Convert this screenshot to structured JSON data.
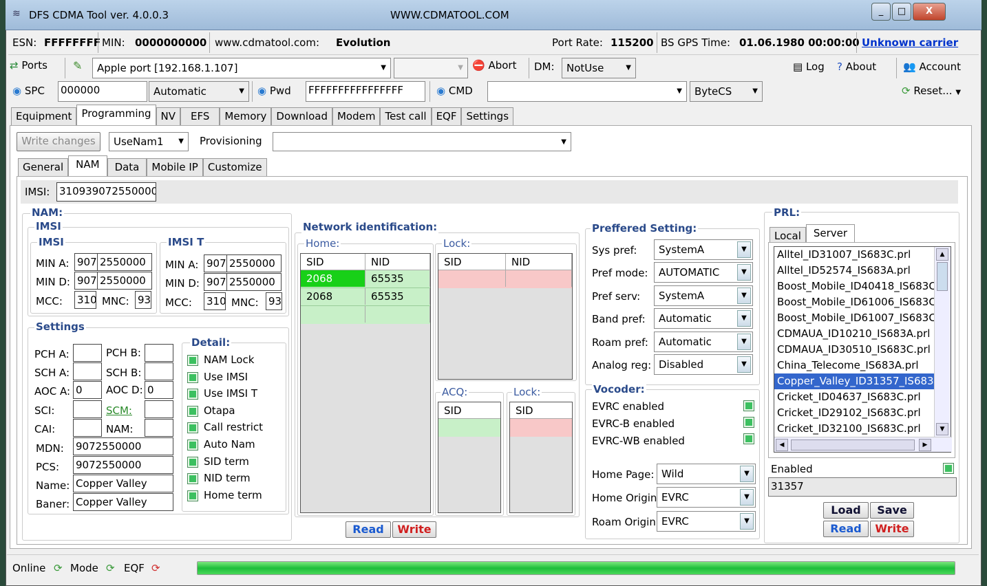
{
  "window": {
    "title": "DFS CDMA Tool ver. 4.0.0.3",
    "url_title": "WWW.CDMATOOL.COM",
    "min_label": "_",
    "max_label": "□",
    "close_label": "X"
  },
  "infobar": {
    "esn_label": "ESN:",
    "esn_value": "FFFFFFFF",
    "min_label": "MIN:",
    "min_value": "0000000000",
    "site_label": "www.cdmatool.com:",
    "site_value": "Evolution",
    "port_rate_label": "Port Rate:",
    "port_rate_value": "115200",
    "gps_label": "BS GPS Time:",
    "gps_value": "01.06.1980 00:00:00",
    "carrier_link": "Unknown carrier"
  },
  "toolbar1": {
    "ports": "Ports",
    "port_value": "Apple port [192.168.1.107]",
    "abort": "Abort",
    "dm_label": "DM:",
    "dm_value": "NotUse",
    "log": "Log",
    "about": "About",
    "account": "Account"
  },
  "toolbar2": {
    "spc_label": "SPC",
    "spc_value": "000000",
    "mode_value": "Automatic",
    "pwd_label": "Pwd",
    "pwd_value": "FFFFFFFFFFFFFFFF",
    "cmd_label": "CMD",
    "cmd_value": "",
    "bytecs_value": "ByteCS",
    "reset": "Reset..."
  },
  "main_tabs": [
    "Equipment",
    "Programming",
    "NV",
    "EFS",
    "Memory",
    "Download",
    "Modem",
    "Test call",
    "EQF",
    "Settings"
  ],
  "prog_bar": {
    "write_changes": "Write changes",
    "nam_select": "UseNam1",
    "provisioning_label": "Provisioning",
    "provisioning_value": ""
  },
  "sub_tabs": [
    "General",
    "NAM",
    "Data",
    "Mobile IP",
    "Customize"
  ],
  "imsi_bar": {
    "label": "IMSI:",
    "value": "310939072550000"
  },
  "nam": {
    "title": "NAM:",
    "imsi_group": "IMSI",
    "imsi": {
      "title": "IMSI",
      "min_a_label": "MIN A:",
      "min_a_1": "907",
      "min_a_2": "2550000",
      "min_d_label": "MIN D:",
      "min_d_1": "907",
      "min_d_2": "2550000",
      "mcc_label": "MCC:",
      "mcc": "310",
      "mnc_label": "MNC:",
      "mnc": "93"
    },
    "imsi_t": {
      "title": "IMSI T",
      "min_a_label": "MIN A:",
      "min_a_1": "907",
      "min_a_2": "2550000",
      "min_d_label": "MIN D:",
      "min_d_1": "907",
      "min_d_2": "2550000",
      "mcc_label": "MCC:",
      "mcc": "310",
      "mnc_label": "MNC:",
      "mnc": "93"
    },
    "settings": {
      "title": "Settings",
      "pch_a": "PCH A:",
      "pch_a_val": "",
      "pch_b": "PCH B:",
      "pch_b_val": "",
      "sch_a": "SCH A:",
      "sch_a_val": "",
      "sch_b": "SCH B:",
      "sch_b_val": "",
      "aoc_a": "AOC A:",
      "aoc_a_val": "0",
      "aoc_d": "AOC D:",
      "aoc_d_val": "0",
      "sci": "SCI:",
      "sci_val": "",
      "scm": "SCM:",
      "scm_val": "",
      "cai": "CAI:",
      "cai_val": "",
      "nam": "NAM:",
      "nam_val": "",
      "mdn": "MDN:",
      "mdn_val": "9072550000",
      "pcs": "PCS:",
      "pcs_val": "9072550000",
      "name": "Name:",
      "name_val": "Copper Valley",
      "baner": "Baner:",
      "baner_val": "Copper Valley"
    },
    "detail": {
      "title": "Detail:",
      "items": [
        "NAM Lock",
        "Use IMSI",
        "Use IMSI T",
        "Otapa",
        "Call restrict",
        "Auto Nam",
        "SID term",
        "NID term",
        "Home term"
      ]
    }
  },
  "network": {
    "title": "Network identification:",
    "home": "Home:",
    "lock": "Lock:",
    "acq": "ACQ:",
    "lock2": "Lock:",
    "sid": "SID",
    "nid": "NID",
    "home_rows": [
      [
        "2068",
        "65535"
      ],
      [
        "2068",
        "65535"
      ]
    ],
    "read": "Read",
    "write": "Write"
  },
  "pref": {
    "title": "Preffered Setting:",
    "sys_pref": "Sys pref:",
    "sys_pref_val": "SystemA",
    "pref_mode": "Pref mode:",
    "pref_mode_val": "AUTOMATIC",
    "pref_serv": "Pref serv:",
    "pref_serv_val": "SystemA",
    "band_pref": "Band pref:",
    "band_pref_val": "Automatic",
    "roam_pref": "Roam pref:",
    "roam_pref_val": "Automatic",
    "analog_reg": "Analog reg:",
    "analog_reg_val": "Disabled"
  },
  "vocoder": {
    "title": "Vocoder:",
    "evrc": "EVRC enabled",
    "evrcb": "EVRC-B enabled",
    "evrcwb": "EVRC-WB enabled",
    "home_page": "Home Page:",
    "home_page_val": "Wild",
    "home_origin": "Home Origin:",
    "home_origin_val": "EVRC",
    "roam_origin": "Roam Origin:",
    "roam_origin_val": "EVRC"
  },
  "prl": {
    "title": "PRL:",
    "tab_local": "Local",
    "tab_server": "Server",
    "items": [
      "Alltel_ID31007_IS683C.prl",
      "Alltel_ID52574_IS683A.prl",
      "Boost_Mobile_ID40418_IS683C",
      "Boost_Mobile_ID61006_IS683C",
      "Boost_Mobile_ID61007_IS683C",
      "CDMAUA_ID10210_IS683A.prl",
      "CDMAUA_ID30510_IS683C.prl",
      "China_Telecome_IS683A.prl",
      "Copper_Valley_ID31357_IS683",
      "Cricket_ID04637_IS683C.prl",
      "Cricket_ID29102_IS683C.prl",
      "Cricket_ID32100_IS683C.prl"
    ],
    "selected_index": 8,
    "enabled_label": "Enabled",
    "value": "31357",
    "load": "Load",
    "save": "Save",
    "read": "Read",
    "write": "Write"
  },
  "statusbar": {
    "online": "Online",
    "mode": "Mode",
    "eqf": "EQF",
    "progress": 1.0
  }
}
